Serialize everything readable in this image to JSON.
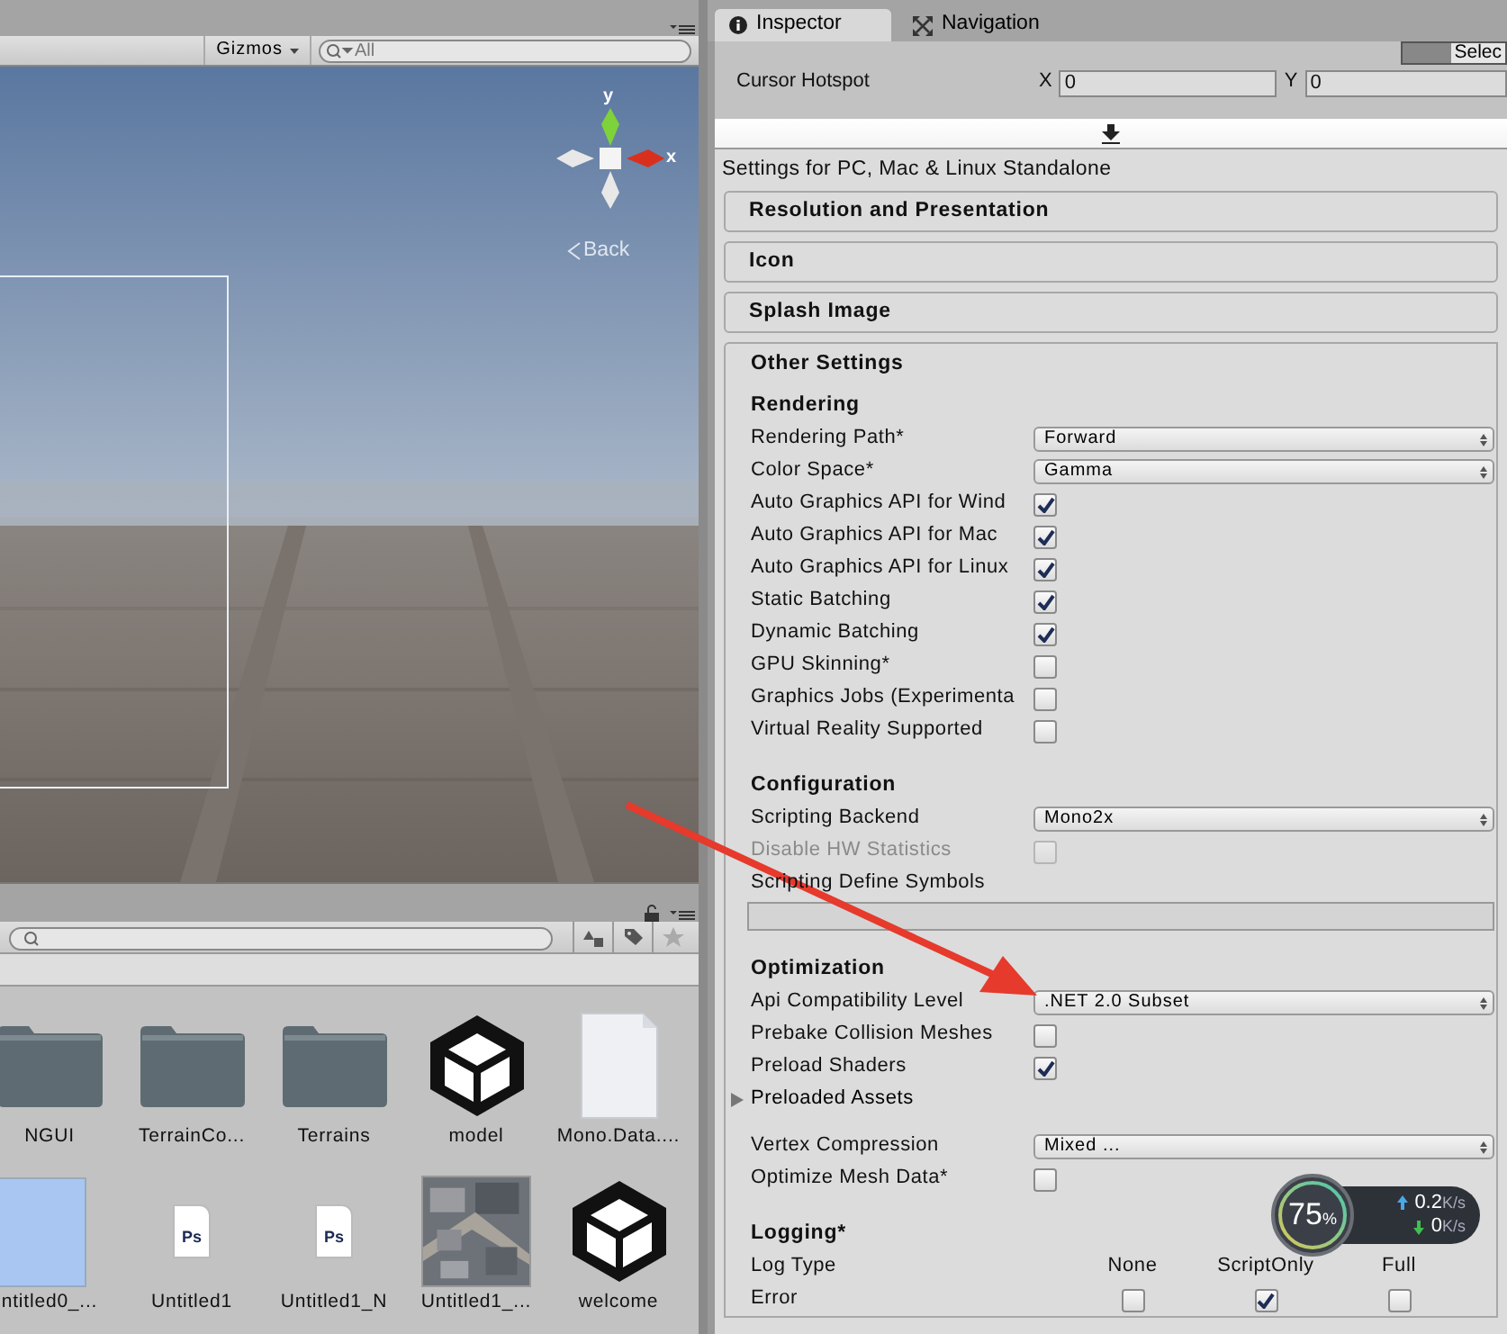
{
  "scene_view": {
    "gizmos_label": "Gizmos",
    "search_placeholder": "All",
    "axis_y": "y",
    "axis_x": "x",
    "back_label": "Back"
  },
  "project": {
    "assets": [
      {
        "kind": "folder",
        "name": "NGUI"
      },
      {
        "kind": "folder",
        "name": "TerrainCo..."
      },
      {
        "kind": "folder",
        "name": "Terrains"
      },
      {
        "kind": "unity",
        "name": "model"
      },
      {
        "kind": "file",
        "name": "Mono.Data...."
      },
      {
        "kind": "swatch",
        "name": "ntitled0_..."
      },
      {
        "kind": "psd",
        "name": "Untitled1",
        "badge": "Ps"
      },
      {
        "kind": "psd",
        "name": "Untitled1_N",
        "badge": "Ps"
      },
      {
        "kind": "picture",
        "name": "Untitled1_..."
      },
      {
        "kind": "unity",
        "name": "welcome"
      }
    ]
  },
  "inspector": {
    "tabs": [
      {
        "label": "Inspector",
        "selected": true
      },
      {
        "label": "Navigation",
        "selected": false
      }
    ],
    "select_button": "Selec",
    "cursor_hotspot": {
      "label": "Cursor Hotspot",
      "x_label": "X",
      "x_value": "0",
      "y_label": "Y",
      "y_value": "0"
    },
    "platform_title": "Settings for PC, Mac & Linux Standalone",
    "sections": [
      {
        "title": "Resolution and Presentation"
      },
      {
        "title": "Icon"
      },
      {
        "title": "Splash Image"
      }
    ],
    "other_settings": {
      "title": "Other Settings",
      "groups": [
        {
          "heading": "Rendering",
          "rows": [
            {
              "kind": "dropdown",
              "label": "Rendering Path*",
              "value": "Forward"
            },
            {
              "kind": "dropdown",
              "label": "Color Space*",
              "value": "Gamma"
            },
            {
              "kind": "checkbox",
              "label": "Auto Graphics API for Wind",
              "checked": true,
              "disabled": false
            },
            {
              "kind": "checkbox",
              "label": "Auto Graphics API for Mac",
              "checked": true,
              "disabled": false
            },
            {
              "kind": "checkbox",
              "label": "Auto Graphics API for Linux",
              "checked": true,
              "disabled": false
            },
            {
              "kind": "checkbox",
              "label": "Static Batching",
              "checked": true,
              "disabled": false
            },
            {
              "kind": "checkbox",
              "label": "Dynamic Batching",
              "checked": true,
              "disabled": false
            },
            {
              "kind": "checkbox",
              "label": "GPU Skinning*",
              "checked": false,
              "disabled": false
            },
            {
              "kind": "checkbox",
              "label": "Graphics Jobs (Experimenta",
              "checked": false,
              "disabled": false
            },
            {
              "kind": "checkbox",
              "label": "Virtual Reality Supported",
              "checked": false,
              "disabled": false
            }
          ]
        },
        {
          "heading": "Configuration",
          "rows": [
            {
              "kind": "dropdown",
              "label": "Scripting Backend",
              "value": "Mono2x"
            },
            {
              "kind": "checkbox",
              "label": "Disable HW Statistics",
              "checked": false,
              "disabled": true
            },
            {
              "kind": "text_field",
              "label": "Scripting Define Symbols"
            }
          ]
        },
        {
          "heading": "Optimization",
          "rows": [
            {
              "kind": "dropdown",
              "label": "Api Compatibility Level",
              "value": ".NET 2.0 Subset"
            },
            {
              "kind": "checkbox",
              "label": "Prebake Collision Meshes",
              "checked": false,
              "disabled": false
            },
            {
              "kind": "checkbox",
              "label": "Preload Shaders",
              "checked": true,
              "disabled": false
            },
            {
              "kind": "foldout",
              "label": "Preloaded Assets",
              "expanded": false
            },
            {
              "kind": "dropdown",
              "label": "Vertex Compression",
              "value": "Mixed ..."
            },
            {
              "kind": "checkbox",
              "label": "Optimize Mesh Data*",
              "checked": false,
              "disabled": false
            }
          ]
        },
        {
          "heading": "Logging*",
          "rows": [
            {
              "kind": "log_header",
              "label": "Log Type",
              "columns": [
                "None",
                "ScriptOnly",
                "Full"
              ]
            },
            {
              "kind": "log_row",
              "label": "Error",
              "checks": [
                false,
                true,
                false
              ]
            }
          ]
        }
      ]
    }
  },
  "net_monitor": {
    "percent": "75",
    "percent_unit": "%",
    "upload": "0.2",
    "upload_unit": "K/s",
    "download": "0",
    "download_unit": "K/s"
  }
}
